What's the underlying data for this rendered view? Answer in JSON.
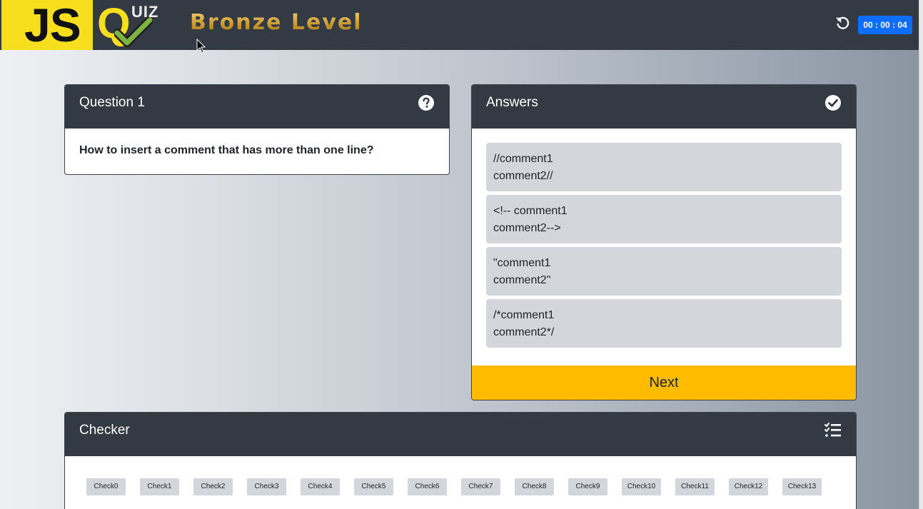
{
  "header": {
    "logo": {
      "js": "JS",
      "quiz_q": "Q",
      "quiz_rest": "UIZ"
    },
    "level_title": "Bronze Level",
    "timer": "00 : 00 : 04",
    "reset_icon": "rotate-left-icon"
  },
  "question_card": {
    "title": "Question 1",
    "icon": "question-circle-icon",
    "text": "How to insert a comment that has more than one line?"
  },
  "answers_card": {
    "title": "Answers",
    "icon": "check-circle-icon",
    "answers": [
      {
        "line1": "//comment1",
        "line2": "comment2//"
      },
      {
        "line1": "<!-- comment1",
        "line2": "comment2-->"
      },
      {
        "line1": "\"comment1",
        "line2": "comment2\""
      },
      {
        "line1": "/*comment1",
        "line2": "comment2*/"
      }
    ],
    "next_label": "Next"
  },
  "checker_card": {
    "title": "Checker",
    "icon": "tasks-list-icon",
    "checks": [
      "Check0",
      "Check1",
      "Check2",
      "Check3",
      "Check4",
      "Check5",
      "Check6",
      "Check7",
      "Check8",
      "Check9",
      "Check10",
      "Check11",
      "Check12",
      "Check13"
    ]
  },
  "colors": {
    "header_bg": "#333a43",
    "js_yellow": "#f7df1e",
    "timer_blue": "#0d6efd",
    "next_amber": "#ffbb00",
    "answer_bg": "#d3d7db"
  }
}
